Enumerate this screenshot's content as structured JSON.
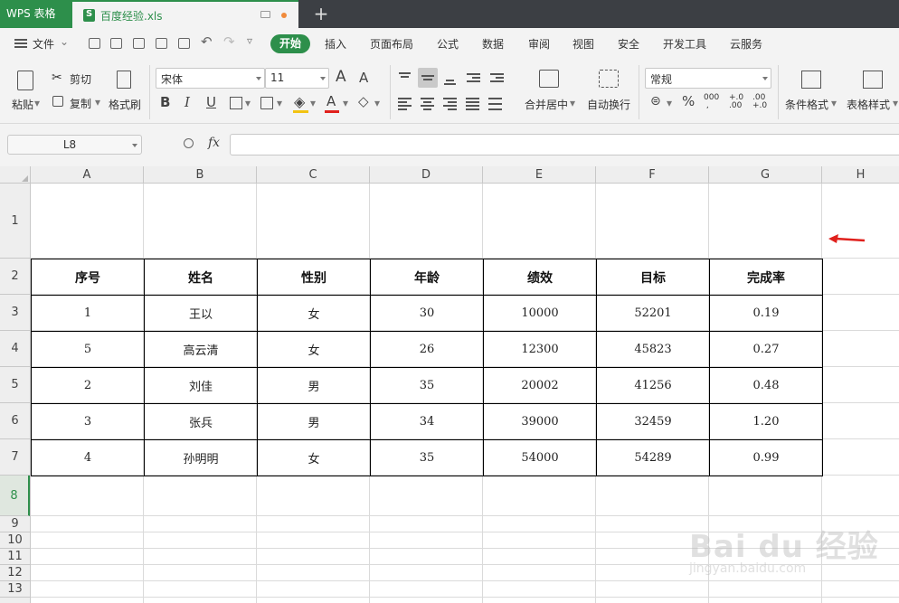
{
  "titlebar": {
    "app_name": "WPS 表格",
    "doc_name": "百度经验.xls",
    "new_tab": "+"
  },
  "menu": {
    "file": "文件",
    "tabs": [
      "开始",
      "插入",
      "页面布局",
      "公式",
      "数据",
      "审阅",
      "视图",
      "安全",
      "开发工具",
      "云服务"
    ]
  },
  "ribbon": {
    "paste": "粘贴",
    "cut": "剪切",
    "copy": "复制",
    "format_painter": "格式刷",
    "font_name": "宋体",
    "font_size": "11",
    "merge_center": "合并居中",
    "wrap_text": "自动换行",
    "number_format": "常规",
    "conditional_format": "条件格式",
    "table_style": "表格样式",
    "bold": "B",
    "italic": "I",
    "underline": "U",
    "font_color_letter": "A",
    "percent": "%",
    "grow_font": "A",
    "shrink_font": "A"
  },
  "formula": {
    "name_box": "L8",
    "fx": "fx",
    "value": ""
  },
  "columns": [
    "A",
    "B",
    "C",
    "D",
    "E",
    "F",
    "G",
    "H"
  ],
  "rows": [
    "1",
    "2",
    "3",
    "4",
    "5",
    "6",
    "7",
    "8",
    "9",
    "10",
    "11",
    "12",
    "13"
  ],
  "selected_row": "8",
  "table": {
    "headers": [
      "序号",
      "姓名",
      "性别",
      "年龄",
      "绩效",
      "目标",
      "完成率"
    ],
    "rows": [
      [
        "1",
        "王以",
        "女",
        "30",
        "10000",
        "52201",
        "0.19"
      ],
      [
        "5",
        "高云清",
        "女",
        "26",
        "12300",
        "45823",
        "0.27"
      ],
      [
        "2",
        "刘佳",
        "男",
        "35",
        "20002",
        "41256",
        "0.48"
      ],
      [
        "3",
        "张兵",
        "男",
        "34",
        "39000",
        "32459",
        "1.20"
      ],
      [
        "4",
        "孙明明",
        "女",
        "35",
        "54000",
        "54289",
        "0.99"
      ]
    ]
  },
  "annotation": {
    "arrow_color": "#e0201c"
  },
  "watermark": {
    "logo": "Bai du 经验",
    "url": "jingyan.baidu.com"
  },
  "colors": {
    "accent": "#2d8f4b",
    "titlebar": "#3c3f44",
    "ribbon_bg": "#f3f3f3"
  }
}
